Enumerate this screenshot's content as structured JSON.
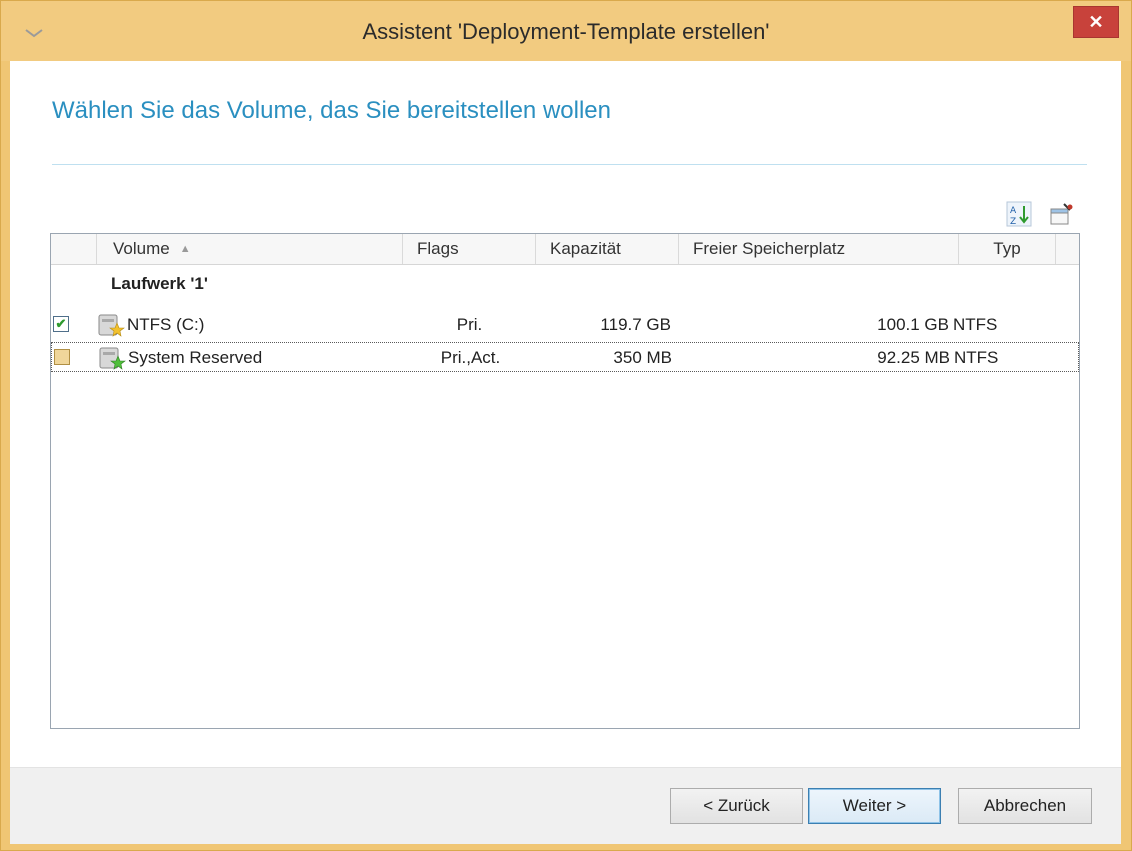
{
  "window": {
    "title": "Assistent 'Deployment-Template erstellen'",
    "close_label": "✕",
    "frame_color": "#f0c674",
    "accent_color": "#2a8fc0"
  },
  "page": {
    "heading": "Wählen Sie das Volume, das Sie bereitstellen wollen"
  },
  "toolbar": {
    "icons": [
      "sort-az-icon",
      "properties-icon"
    ]
  },
  "table": {
    "columns": {
      "volume": "Volume",
      "flags": "Flags",
      "capacity": "Kapazität",
      "free": "Freier Speicherplatz",
      "type": "Typ"
    },
    "sort_icon": "sort-ascending-icon",
    "group_label": "Laufwerk '1'",
    "rows": [
      {
        "checked": true,
        "volume": "NTFS (C:)",
        "flags": "Pri.",
        "capacity": "119.7 GB",
        "free": "100.1 GB",
        "type": "NTFS",
        "icon": "drive-icon"
      },
      {
        "checked": false,
        "volume": "System Reserved",
        "flags": "Pri.,Act.",
        "capacity": "350 MB",
        "free": "92.25 MB",
        "type": "NTFS",
        "icon": "drive-active-icon"
      }
    ]
  },
  "buttons": {
    "back": "< Zurück",
    "next": "Weiter >",
    "cancel": "Abbrechen"
  }
}
